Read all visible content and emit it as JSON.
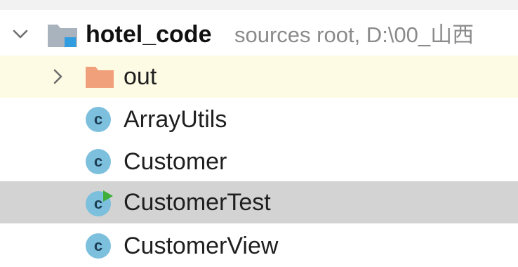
{
  "tree": {
    "root": {
      "name": "hotel_code",
      "hint": "sources root,  D:\\00_山西",
      "expanded": true,
      "icon": "module-folder-icon"
    },
    "items": [
      {
        "label": "out",
        "type": "folder",
        "icon": "folder-icon",
        "collapsed": true,
        "highlight": true
      },
      {
        "label": "ArrayUtils",
        "type": "class",
        "icon": "class-icon",
        "icon_letter": "c"
      },
      {
        "label": "Customer",
        "type": "class",
        "icon": "class-icon",
        "icon_letter": "c"
      },
      {
        "label": "CustomerTest",
        "type": "class-runnable",
        "icon": "runnable-class-icon",
        "icon_letter": "c",
        "selected": true
      },
      {
        "label": "CustomerView",
        "type": "class",
        "icon": "class-icon",
        "icon_letter": "c"
      }
    ]
  },
  "colors": {
    "highlight_row": "#fdfbe4",
    "selected_row": "#d3d3d3",
    "class_icon": "#7cc0dd",
    "folder_orange": "#f0a07a",
    "run_green": "#3fae3a",
    "module_blue": "#2f9de0"
  }
}
